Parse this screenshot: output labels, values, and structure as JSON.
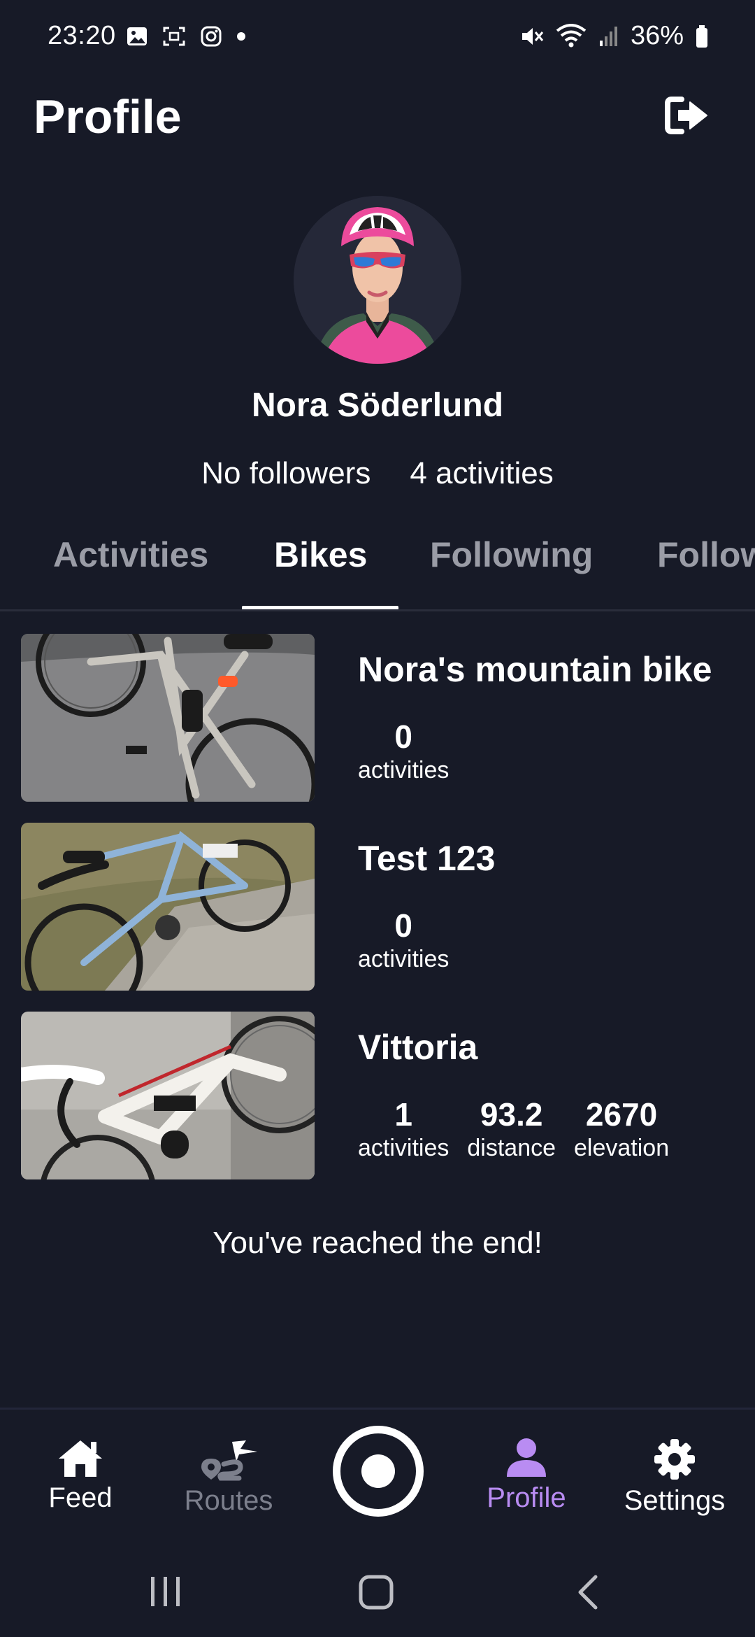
{
  "status_bar": {
    "time": "23:20",
    "battery": "36%"
  },
  "header": {
    "title": "Profile"
  },
  "user": {
    "name": "Nora Söderlund",
    "followers": "No followers",
    "activities": "4 activities"
  },
  "tabs": [
    {
      "label": "Activities"
    },
    {
      "label": "Bikes"
    },
    {
      "label": "Following"
    },
    {
      "label": "Followers"
    }
  ],
  "bikes": [
    {
      "name": "Nora's mountain bike",
      "stats": [
        {
          "value": "0",
          "label": "activities"
        }
      ]
    },
    {
      "name": "Test 123",
      "stats": [
        {
          "value": "0",
          "label": "activities"
        }
      ]
    },
    {
      "name": "Vittoria",
      "stats": [
        {
          "value": "1",
          "label": "activities"
        },
        {
          "value": "93.2",
          "label": "distance"
        },
        {
          "value": "2670",
          "label": "elevation"
        }
      ]
    }
  ],
  "end_message": "You've reached the end!",
  "bottom_nav": {
    "feed": "Feed",
    "routes": "Routes",
    "profile": "Profile",
    "settings": "Settings"
  },
  "colors": {
    "background": "#171a27",
    "accent": "#b98cf2",
    "avatar_accent": "#e83e8c"
  }
}
